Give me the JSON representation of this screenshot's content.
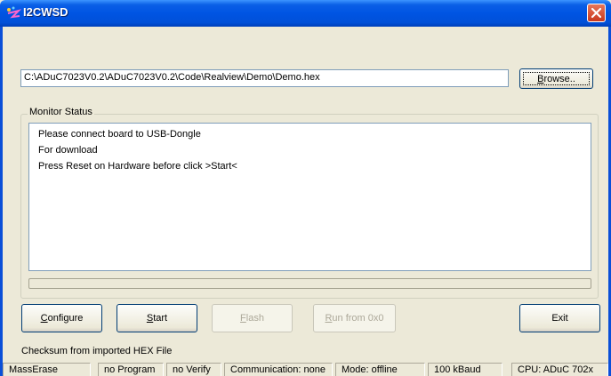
{
  "window": {
    "title": "I2CWSD",
    "icon": "app-icon",
    "close_icon": "close-icon"
  },
  "file": {
    "path": "C:\\ADuC7023V0.2\\ADuC7023V0.2\\Code\\Realview\\Demo\\Demo.hex",
    "browse_label": "Browse.."
  },
  "monitor": {
    "group_label": "Monitor Status",
    "lines": [
      "Please connect board to USB-Dongle",
      "For download",
      "Press Reset on Hardware before click >Start<"
    ]
  },
  "buttons": {
    "configure": "Configure",
    "start": "Start",
    "flash": "Flash",
    "run_from": "Run from 0x0",
    "exit": "Exit"
  },
  "checksum_text": "Checksum from imported HEX File",
  "status_bar": [
    "MassErase",
    "no Program",
    "no Verify",
    "Communication: none",
    "Mode: offline",
    "100 kBaud",
    "CPU: ADuC 702x"
  ],
  "colors": {
    "titlebar": "#0054e3",
    "face": "#ece9d8",
    "close_button": "#c8381d"
  }
}
